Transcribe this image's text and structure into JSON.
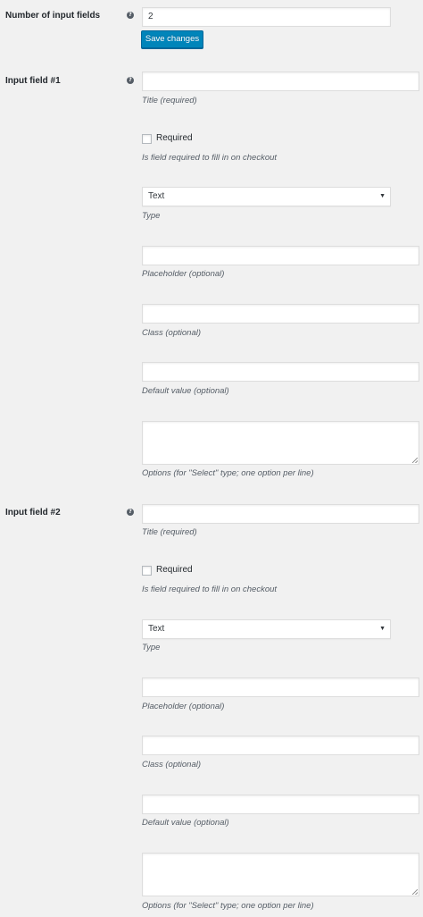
{
  "settings": {
    "num_fields_label": "Number of input fields",
    "num_fields_value": "2",
    "save_label": "Save changes",
    "help_glyph": "?"
  },
  "fields": [
    {
      "label": "Input field #1",
      "title_value": "",
      "title_desc": "Title (required)",
      "required_label": "Required",
      "required_checked": false,
      "required_desc": "Is field required to fill in on checkout",
      "type_value": "Text",
      "type_desc": "Type",
      "placeholder_value": "",
      "placeholder_desc": "Placeholder (optional)",
      "class_value": "",
      "class_desc": "Class (optional)",
      "default_value": "",
      "default_desc": "Default value (optional)",
      "options_value": "",
      "options_desc": "Options (for \"Select\" type; one option per line)"
    },
    {
      "label": "Input field #2",
      "title_value": "",
      "title_desc": "Title (required)",
      "required_label": "Required",
      "required_checked": false,
      "required_desc": "Is field required to fill in on checkout",
      "type_value": "Text",
      "type_desc": "Type",
      "placeholder_value": "",
      "placeholder_desc": "Placeholder (optional)",
      "class_value": "",
      "class_desc": "Class (optional)",
      "default_value": "",
      "default_desc": "Default value (optional)",
      "options_value": "",
      "options_desc": "Options (for \"Select\" type; one option per line)"
    }
  ],
  "icons": {
    "help": "help-icon",
    "caret": "chevron-down-icon",
    "caret_glyph": "▼"
  },
  "colors": {
    "page_bg": "#f1f1f1",
    "primary_button": "#0085ba",
    "help_icon": "#555d66"
  }
}
